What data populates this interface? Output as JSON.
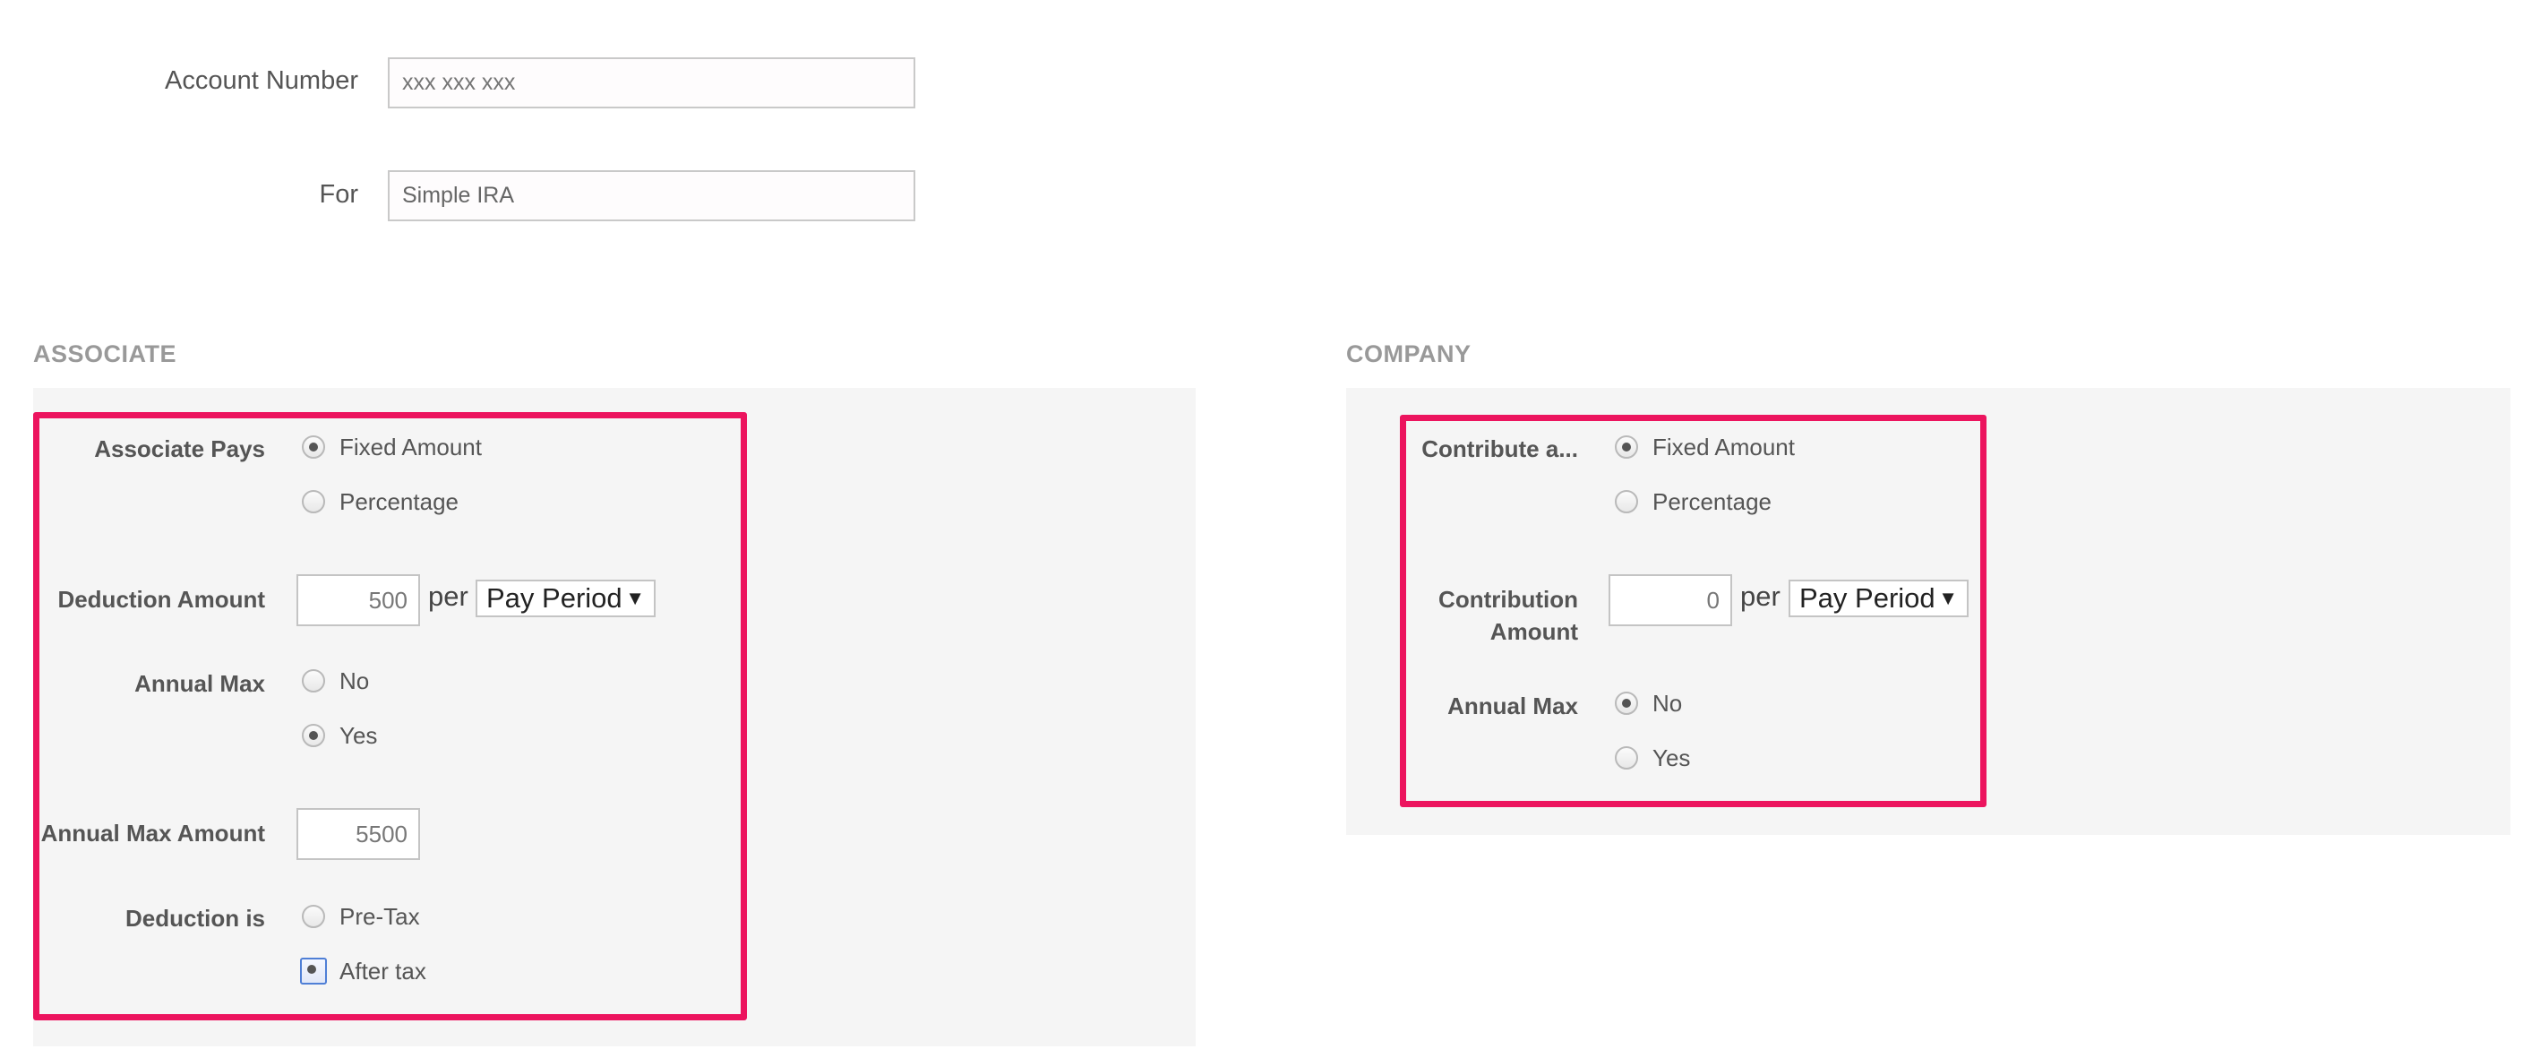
{
  "account": {
    "account_number_label": "Account Number",
    "account_number_placeholder": "xxx xxx xxx",
    "for_label": "For",
    "for_value": "Simple IRA"
  },
  "associate": {
    "title": "ASSOCIATE",
    "pays_label": "Associate Pays",
    "pays_options": [
      "Fixed Amount",
      "Percentage"
    ],
    "pays_selected": "Fixed Amount",
    "deduction_amount_label": "Deduction Amount",
    "deduction_amount_value": "500",
    "per_label": "per",
    "period_value": "Pay Period",
    "annual_max_label": "Annual Max",
    "annual_max_options": [
      "No",
      "Yes"
    ],
    "annual_max_selected": "Yes",
    "annual_max_amount_label": "Annual Max Amount",
    "annual_max_amount_value": "5500",
    "deduction_is_label": "Deduction is",
    "deduction_is_options": [
      "Pre-Tax",
      "After tax"
    ],
    "deduction_is_selected": "After tax"
  },
  "company": {
    "title": "COMPANY",
    "contribute_label": "Contribute a...",
    "contribute_options": [
      "Fixed Amount",
      "Percentage"
    ],
    "contribute_selected": "Fixed Amount",
    "contribution_amount_label_line1": "Contribution",
    "contribution_amount_label_line2": "Amount",
    "contribution_amount_value": "0",
    "per_label": "per",
    "period_value": "Pay Period",
    "annual_max_label": "Annual Max",
    "annual_max_options": [
      "No",
      "Yes"
    ],
    "annual_max_selected": "No"
  },
  "colors": {
    "highlight": "#ec145e",
    "panel_bg": "#f5f5f5",
    "section_title": "#999999"
  },
  "icons": {
    "dropdown": "dropdown-arrow-icon"
  }
}
